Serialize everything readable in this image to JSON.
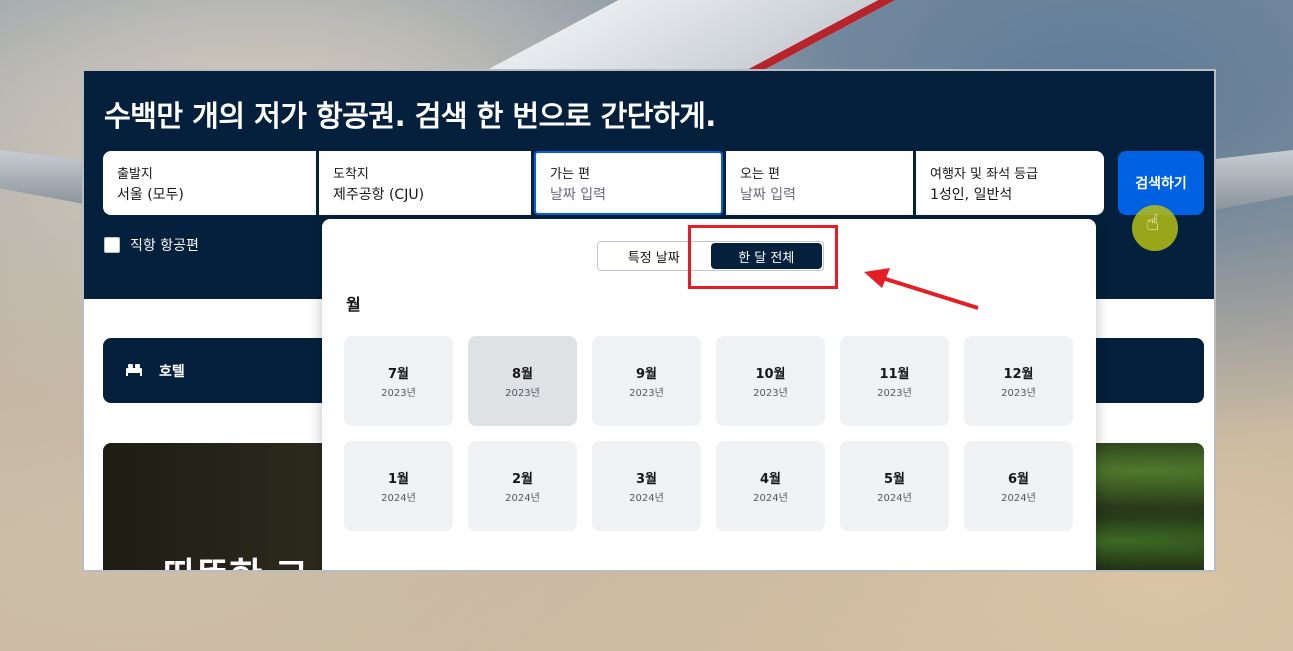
{
  "hero": {
    "headline": "수백만 개의 저가 항공권. 검색 한 번으로 간단하게.",
    "fields": {
      "origin": {
        "label": "출발지",
        "value": "서울 (모두)"
      },
      "destination": {
        "label": "도착지",
        "value": "제주공항 (CJU)"
      },
      "depart": {
        "label": "가는 편",
        "placeholder": "날짜 입력"
      },
      "return": {
        "label": "오는 편",
        "placeholder": "날짜 입력"
      },
      "travellers": {
        "label": "여행자 및 좌석 등급",
        "value": "1성인, 일반석"
      }
    },
    "search_label": "검색하기",
    "direct_label": "직항 항공편"
  },
  "hotel": {
    "label": "호텔"
  },
  "promo": {
    "text": "따뜻한 고"
  },
  "calendar": {
    "toggle": {
      "specific": "특정 날짜",
      "whole_month": "한 달 전체"
    },
    "section_title": "월",
    "months": [
      {
        "m": "7월",
        "y": "2023년"
      },
      {
        "m": "8월",
        "y": "2023년",
        "selected": true
      },
      {
        "m": "9월",
        "y": "2023년"
      },
      {
        "m": "10월",
        "y": "2023년"
      },
      {
        "m": "11월",
        "y": "2023년"
      },
      {
        "m": "12월",
        "y": "2023년"
      },
      {
        "m": "1월",
        "y": "2024년"
      },
      {
        "m": "2월",
        "y": "2024년"
      },
      {
        "m": "3월",
        "y": "2024년"
      },
      {
        "m": "4월",
        "y": "2024년"
      },
      {
        "m": "5월",
        "y": "2024년"
      },
      {
        "m": "6월",
        "y": "2024년"
      }
    ]
  },
  "colors": {
    "navy": "#05203c",
    "accent": "#0062e3",
    "highlight": "#e51d24"
  }
}
